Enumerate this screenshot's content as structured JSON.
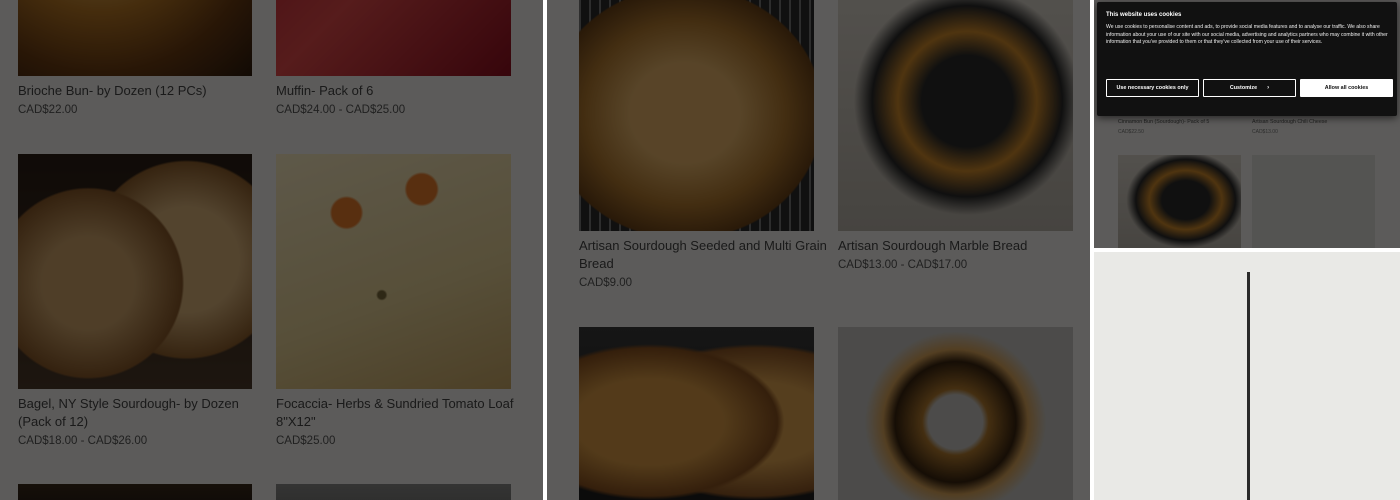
{
  "panel1": {
    "products": [
      {
        "name": "Brioche Bun- by Dozen (12 PCs)",
        "price": "CAD$22.00"
      },
      {
        "name": "Muffin- Pack of 6",
        "price": "CAD$24.00 - CAD$25.00"
      },
      {
        "name_line1": "Bagel, NY Style Sourdough- by Dozen",
        "name_line2": "(Pack of 12)",
        "price": "CAD$18.00 - CAD$26.00"
      },
      {
        "name_line1": "Focaccia- Herbs & Sundried Tomato Loaf",
        "name_line2": "8\"X12\"",
        "price": "CAD$25.00"
      }
    ]
  },
  "panel2": {
    "products": [
      {
        "name_line1": "Artisan Sourdough Seeded and Multi Grain",
        "name_line2": "Bread",
        "price": "CAD$9.00"
      },
      {
        "name": "Artisan Sourdough Marble Bread",
        "price": "CAD$13.00 - CAD$17.00"
      }
    ]
  },
  "panel3": {
    "cookie": {
      "title": "This website uses cookies",
      "body": "We use cookies to personalise content and ads, to provide social media features and to analyse our traffic. We also share information about your use of our site with our social media, advertising and analytics partners who may combine it with other information that you've provided to them or that they've collected from your use of their services.",
      "btn_necessary": "Use necessary cookies only",
      "btn_customize": "Customize",
      "btn_allow": "Allow all cookies"
    },
    "products": [
      {
        "name": "Cinnamon Bun (Sourdough)- Pack of 5",
        "price": "CAD$22.50"
      },
      {
        "name": "Artisan Sourdough Chili Cheese",
        "price": "CAD$13.00"
      }
    ]
  },
  "colors": {
    "overlay": "#000000",
    "dialog_bg": "#111111",
    "text": "#444444"
  }
}
